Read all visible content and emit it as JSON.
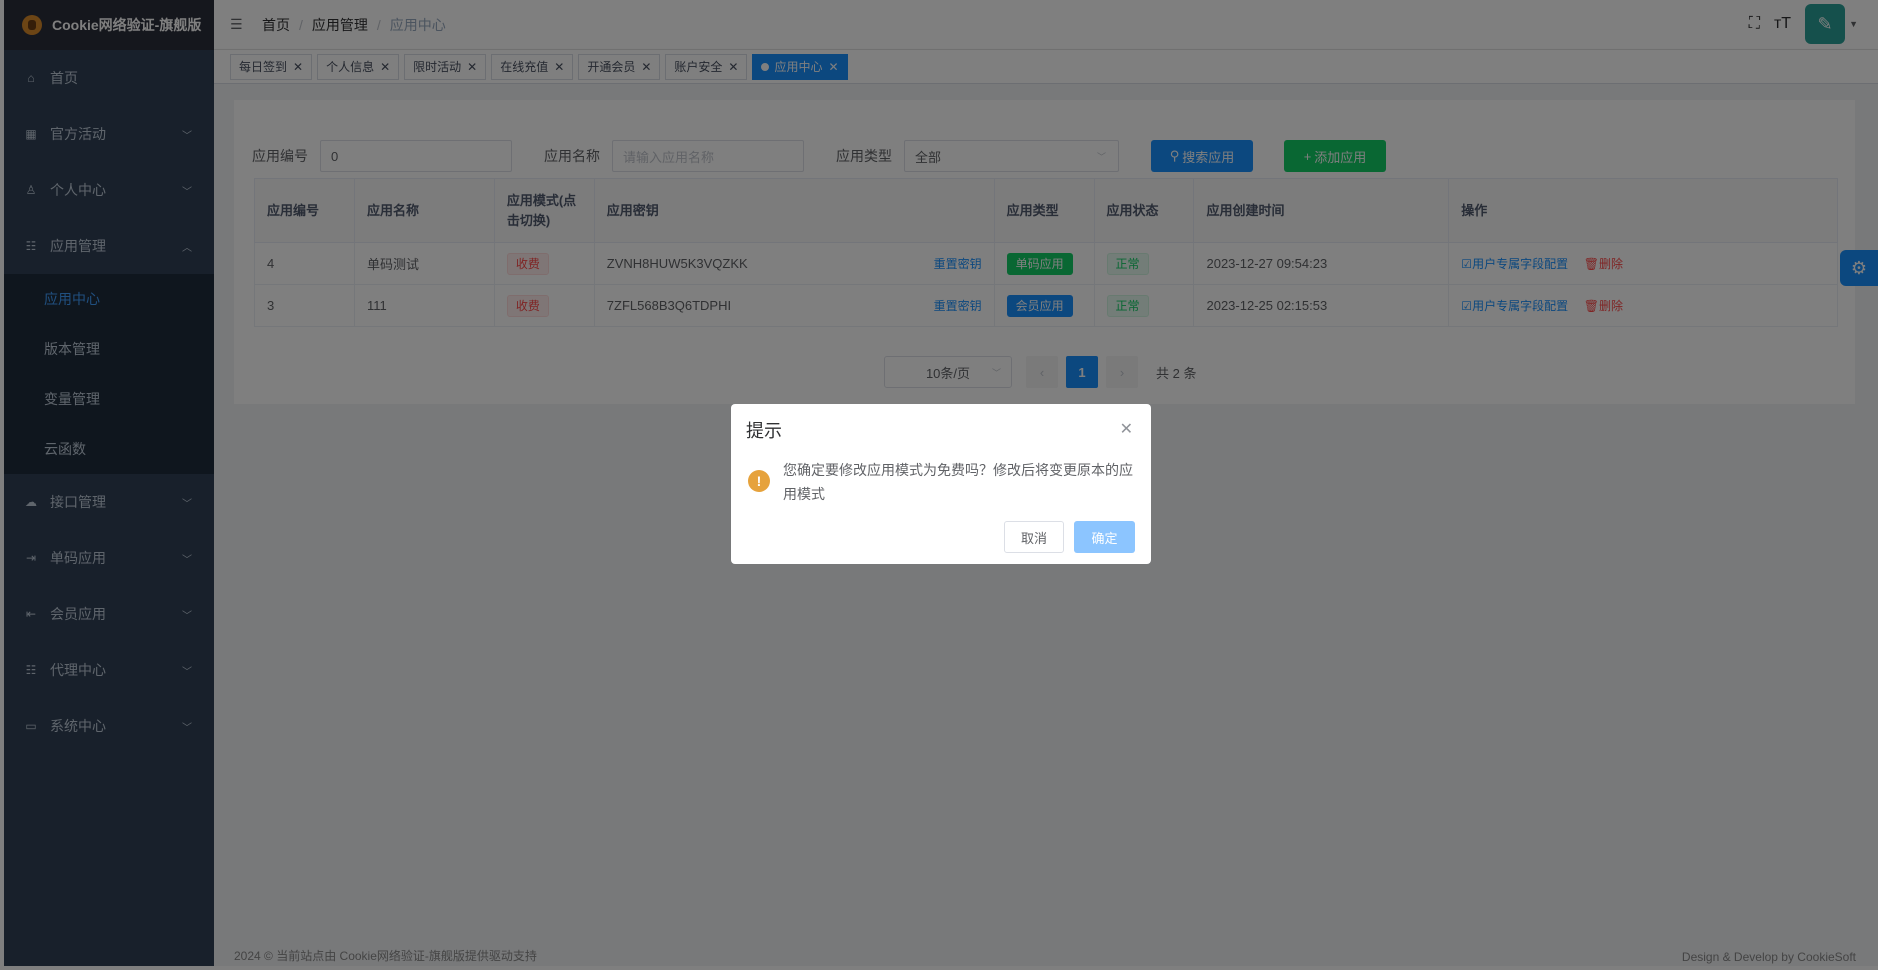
{
  "app": {
    "title": "Cookie网络验证-旗舰版"
  },
  "sidebar": {
    "items": [
      {
        "label": "首页",
        "icon": "home-icon"
      },
      {
        "label": "官方活动",
        "icon": "grid-icon"
      },
      {
        "label": "个人中心",
        "icon": "user-icon"
      },
      {
        "label": "应用管理",
        "icon": "tree-icon",
        "expanded": true
      },
      {
        "label": "接口管理",
        "icon": "cloud-icon"
      },
      {
        "label": "单码应用",
        "icon": "login-icon"
      },
      {
        "label": "会员应用",
        "icon": "logout-icon"
      },
      {
        "label": "代理中心",
        "icon": "tree-icon"
      },
      {
        "label": "系统中心",
        "icon": "monitor-icon"
      }
    ],
    "submenu": [
      "应用中心",
      "版本管理",
      "变量管理",
      "云函数"
    ]
  },
  "breadcrumb": [
    "首页",
    "应用管理",
    "应用中心"
  ],
  "tags": [
    "每日签到",
    "个人信息",
    "限时活动",
    "在线充值",
    "开通会员",
    "账户安全",
    "应用中心"
  ],
  "filters": {
    "id_label": "应用编号",
    "id_value": "0",
    "name_label": "应用名称",
    "name_placeholder": "请输入应用名称",
    "type_label": "应用类型",
    "type_value": "全部",
    "search_btn": "搜索应用",
    "add_btn": "添加应用"
  },
  "table": {
    "headers": [
      "应用编号",
      "应用名称",
      "应用模式(点击切换)",
      "应用密钥",
      "应用类型",
      "应用状态",
      "应用创建时间",
      "操作"
    ],
    "rows": [
      {
        "id": "4",
        "name": "单码测试",
        "mode": "收费",
        "secret": "ZVNH8HUW5K3VQZKK",
        "reset": "重置密钥",
        "type": "单码应用",
        "status": "正常",
        "created": "2023-12-27 09:54:23",
        "op_config": "用户专属字段配置",
        "op_delete": "删除"
      },
      {
        "id": "3",
        "name": "111",
        "mode": "收费",
        "secret": "7ZFL568B3Q6TDPHI",
        "reset": "重置密钥",
        "type": "会员应用",
        "status": "正常",
        "created": "2023-12-25 02:15:53",
        "op_config": "用户专属字段配置",
        "op_delete": "删除"
      }
    ]
  },
  "pagination": {
    "page_size": "10条/页",
    "current": "1",
    "total": "共 2 条"
  },
  "footer": {
    "left": "2024 © 当前站点由 Cookie网络验证-旗舰版提供驱动支持",
    "right": "Design & Develop by CookieSoft"
  },
  "dialog": {
    "title": "提示",
    "message": "您确定要修改应用模式为免费吗？修改后将变更原本的应用模式",
    "cancel": "取消",
    "confirm": "确定"
  },
  "colors": {
    "primary": "#1890ff",
    "success": "#13ce66",
    "danger": "#ff4949",
    "warning": "#e6a23c",
    "sidebar": "#304156"
  }
}
